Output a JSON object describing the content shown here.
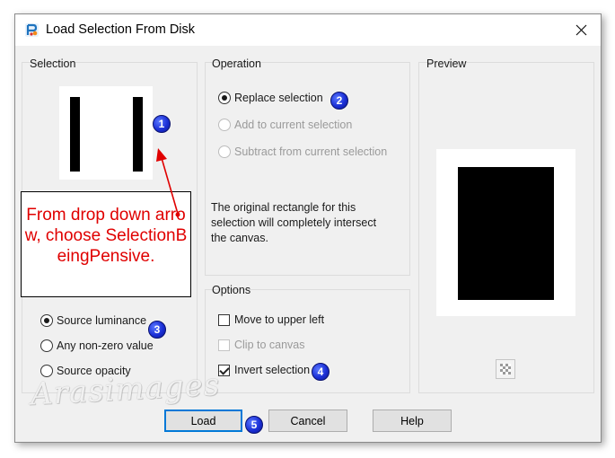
{
  "window": {
    "title": "Load Selection From Disk",
    "close_glyph": "✕"
  },
  "selection_group": {
    "title": "Selection",
    "radios": [
      {
        "label": "Source luminance",
        "checked": true
      },
      {
        "label": "Any non-zero value",
        "checked": false
      },
      {
        "label": "Source opacity",
        "checked": false
      }
    ]
  },
  "operation_group": {
    "title": "Operation",
    "radios": [
      {
        "label": "Replace selection",
        "checked": true,
        "enabled": true
      },
      {
        "label": "Add to current selection",
        "checked": false,
        "enabled": false
      },
      {
        "label": "Subtract from current selection",
        "checked": false,
        "enabled": false
      }
    ],
    "description": "The original rectangle for this selection will completely intersect the canvas."
  },
  "options_group": {
    "title": "Options",
    "checkboxes": [
      {
        "label": "Move to upper left",
        "checked": false,
        "enabled": true
      },
      {
        "label": "Clip to canvas",
        "checked": false,
        "enabled": false
      },
      {
        "label": "Invert selection",
        "checked": true,
        "enabled": true
      }
    ]
  },
  "preview_group": {
    "title": "Preview"
  },
  "buttons": {
    "load": "Load",
    "cancel": "Cancel",
    "help": "Help"
  },
  "annotation": {
    "text": "From drop down arrow, choose SelectionBeingPensive.",
    "color": "#e00000"
  },
  "badges": [
    "1",
    "2",
    "3",
    "4",
    "5"
  ],
  "watermark": "Arasimages",
  "colors": {
    "dialog_bg": "#f0f0f0",
    "default_button_border": "#0078d7",
    "badge_blue": "#1b2fd6"
  }
}
